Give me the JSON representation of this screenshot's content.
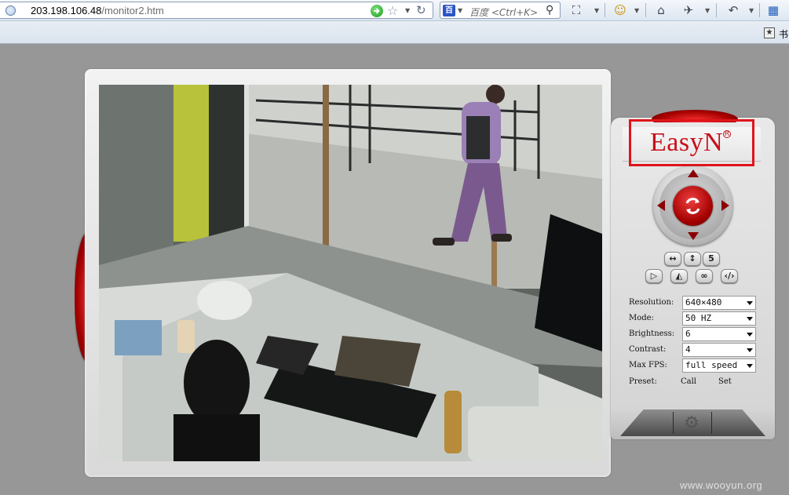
{
  "browser": {
    "url_host": "203.198.106.48",
    "url_path": "/monitor2.htm",
    "search_placeholder": "百度 <Ctrl+K>",
    "search_engine_label": "百",
    "bookmark_label": "书",
    "bookmark_icon": "star-icon",
    "toolbar_icons": [
      "screenshot-icon",
      "emoji-icon",
      "home-icon",
      "addon-icon",
      "undo-icon",
      "apps-icon"
    ]
  },
  "camera": {
    "brand": "EasyN",
    "brand_mark": "R",
    "view": "live-video-feed"
  },
  "controls": {
    "flip_horizontal": "↔",
    "flip_vertical": "↕",
    "speed_value": "5",
    "mirror_buttons": [
      "play-icon",
      "mirror-icon",
      "infinite-icon",
      "code-icon"
    ]
  },
  "settings": {
    "resolution": {
      "label": "Resolution:",
      "value": "640×480"
    },
    "mode": {
      "label": "Mode:",
      "value": "50 HZ"
    },
    "brightness": {
      "label": "Brightness:",
      "value": "6"
    },
    "contrast": {
      "label": "Contrast:",
      "value": "4"
    },
    "max_fps": {
      "label": "Max FPS:",
      "value": "full speed"
    },
    "preset": {
      "label": "Preset:",
      "call": "Call",
      "set": "Set"
    }
  },
  "watermark": "www.wooyun.org",
  "colors": {
    "brand_red": "#c8101a",
    "highlight": "#e0141b",
    "page_bg": "#979797"
  }
}
